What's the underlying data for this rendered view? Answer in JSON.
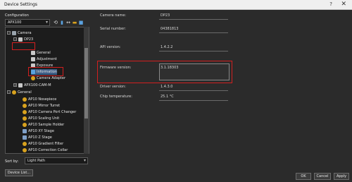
{
  "window": {
    "title": "Device Settings",
    "help": "?",
    "close": "✕"
  },
  "left": {
    "configuration_label": "Configuration",
    "configuration_value": "APX100",
    "tree": [
      {
        "label": "Camera",
        "icon": "camera-icon",
        "expander": "−"
      },
      {
        "label": "DP23",
        "icon": "camera-icon",
        "expander": "−"
      },
      {
        "label": "General",
        "icon": "camera-icon"
      },
      {
        "label": "Adjustment",
        "icon": "camera-icon"
      },
      {
        "label": "Exposure",
        "icon": "camera-icon"
      },
      {
        "label": "Information",
        "icon": "info-icon"
      },
      {
        "label": "Camera Adapter",
        "icon": "gear-icon"
      },
      {
        "label": "APX100-CAM-M",
        "icon": "camera-icon",
        "expander": "+"
      },
      {
        "label": "General",
        "icon": "gear-icon",
        "expander": "−"
      },
      {
        "label": "AP10 Nosepiece",
        "icon": "gear-icon"
      },
      {
        "label": "AP10 Mirror Turret",
        "icon": "gear-icon"
      },
      {
        "label": "AP10 Camera Port Changer",
        "icon": "gear-icon"
      },
      {
        "label": "AP10 Scaling Unit",
        "icon": "gear-icon"
      },
      {
        "label": "AP10 Sample Holder",
        "icon": "gear-icon"
      },
      {
        "label": "AP10 XY Stage",
        "icon": "stage-icon"
      },
      {
        "label": "AP10 Z Stage",
        "icon": "stage-icon"
      },
      {
        "label": "AP10 Gradient Filter",
        "icon": "gear-icon"
      },
      {
        "label": "AP10 Correction Collar",
        "icon": "gear-icon"
      }
    ],
    "sort_label": "Sort by:",
    "sort_value": "Light Path",
    "device_list_button": "Device List..."
  },
  "properties": {
    "camera_name_label": "Camera name:",
    "camera_name_value": "DP23",
    "serial_label": "Serial number:",
    "serial_value": "04381813",
    "api_label": "API version:",
    "api_value": "1.4.2.2",
    "firmware_label": "Firmware version:",
    "firmware_value": "3.1.18303",
    "driver_label": "Driver version:",
    "driver_value": "1.4.3.0",
    "chip_label": "Chip temperature:",
    "chip_value": "25.1 °C"
  },
  "footer": {
    "ok": "OK",
    "cancel": "Cancel",
    "apply": "Apply"
  }
}
